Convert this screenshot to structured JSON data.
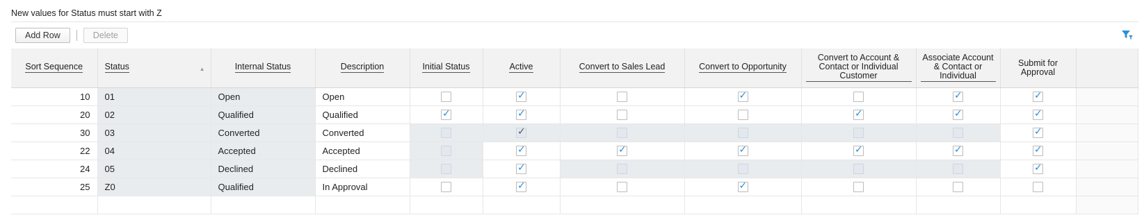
{
  "note": "New values for Status must start with Z",
  "toolbar": {
    "add_row": "Add Row",
    "delete": "Delete"
  },
  "columns": {
    "sort_sequence": "Sort Sequence",
    "status": "Status",
    "internal_status": "Internal Status",
    "description": "Description",
    "initial_status": "Initial Status",
    "active": "Active",
    "convert_lead": "Convert to Sales Lead",
    "convert_opp": "Convert to Opportunity",
    "convert_account": "Convert to Account & Contact or Individual Customer",
    "associate_account": "Associate Account & Contact or Individual",
    "submit_approval": "Submit for Approval"
  },
  "icons": {
    "filter": "filter-icon",
    "sort": "sort-ascending-icon"
  },
  "colors": {
    "check": "#2b8fd6",
    "readonly_bg": "#e9ecef"
  },
  "rows": [
    {
      "sort": "10",
      "status": "01",
      "internal": "Open",
      "description": "Open",
      "checks": [
        {
          "v": false,
          "e": true
        },
        {
          "v": true,
          "e": true
        },
        {
          "v": false,
          "e": true
        },
        {
          "v": true,
          "e": true
        },
        {
          "v": false,
          "e": true
        },
        {
          "v": true,
          "e": true
        },
        {
          "v": true,
          "e": true
        }
      ]
    },
    {
      "sort": "20",
      "status": "02",
      "internal": "Qualified",
      "description": "Qualified",
      "checks": [
        {
          "v": true,
          "e": true
        },
        {
          "v": true,
          "e": true
        },
        {
          "v": false,
          "e": true
        },
        {
          "v": false,
          "e": true
        },
        {
          "v": true,
          "e": true
        },
        {
          "v": true,
          "e": true
        },
        {
          "v": true,
          "e": true
        }
      ]
    },
    {
      "sort": "30",
      "status": "03",
      "internal": "Converted",
      "description": "Converted",
      "checks": [
        {
          "v": false,
          "e": false
        },
        {
          "v": true,
          "e": false,
          "dark": true
        },
        {
          "v": false,
          "e": false
        },
        {
          "v": false,
          "e": false
        },
        {
          "v": false,
          "e": false
        },
        {
          "v": false,
          "e": false
        },
        {
          "v": true,
          "e": true
        }
      ]
    },
    {
      "sort": "22",
      "status": "04",
      "internal": "Accepted",
      "description": "Accepted",
      "checks": [
        {
          "v": false,
          "e": false
        },
        {
          "v": true,
          "e": true
        },
        {
          "v": true,
          "e": true
        },
        {
          "v": true,
          "e": true
        },
        {
          "v": true,
          "e": true
        },
        {
          "v": true,
          "e": true
        },
        {
          "v": true,
          "e": true
        }
      ]
    },
    {
      "sort": "24",
      "status": "05",
      "internal": "Declined",
      "description": "Declined",
      "checks": [
        {
          "v": false,
          "e": false
        },
        {
          "v": true,
          "e": true
        },
        {
          "v": false,
          "e": false
        },
        {
          "v": false,
          "e": false
        },
        {
          "v": false,
          "e": false
        },
        {
          "v": false,
          "e": false
        },
        {
          "v": true,
          "e": true
        }
      ]
    },
    {
      "sort": "25",
      "status": "Z0",
      "internal": "Qualified",
      "description": "In Approval",
      "checks": [
        {
          "v": false,
          "e": true
        },
        {
          "v": true,
          "e": true
        },
        {
          "v": false,
          "e": true
        },
        {
          "v": true,
          "e": true
        },
        {
          "v": false,
          "e": true
        },
        {
          "v": false,
          "e": true
        },
        {
          "v": false,
          "e": true
        }
      ]
    }
  ]
}
